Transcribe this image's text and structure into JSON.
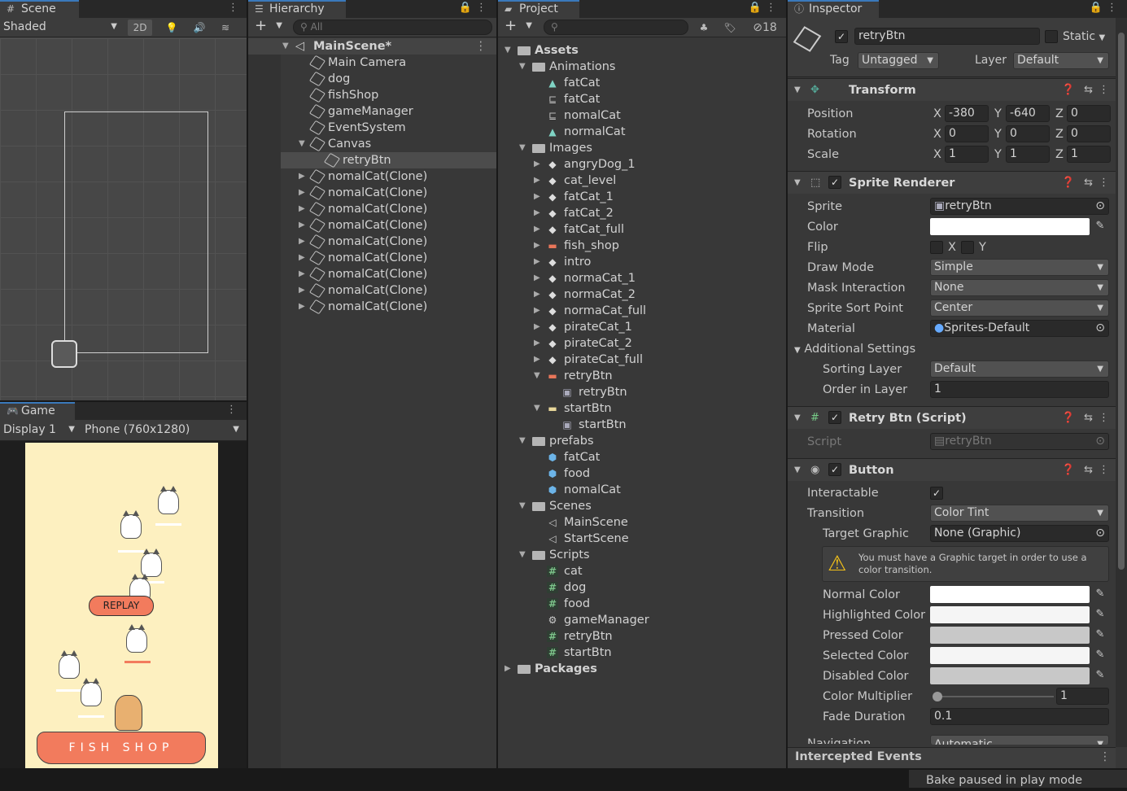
{
  "scene": {
    "tab": "Scene",
    "shading": "Shaded",
    "mode_2d": "2D"
  },
  "game": {
    "tab": "Game",
    "display": "Display 1",
    "resolution": "Phone (760x1280)",
    "replay_label": "REPLAY",
    "shop_sign": "FISH SHOP",
    "bg_color": "#fdf0c0",
    "awning_color": "#f27b5d"
  },
  "hierarchy": {
    "tab": "Hierarchy",
    "search_placeholder": "All",
    "scene_name": "MainScene*",
    "items": [
      {
        "label": "Main Camera",
        "depth": 1,
        "tri": ""
      },
      {
        "label": "dog",
        "depth": 1,
        "tri": ""
      },
      {
        "label": "fishShop",
        "depth": 1,
        "tri": ""
      },
      {
        "label": "gameManager",
        "depth": 1,
        "tri": ""
      },
      {
        "label": "EventSystem",
        "depth": 1,
        "tri": ""
      },
      {
        "label": "Canvas",
        "depth": 1,
        "tri": "open"
      },
      {
        "label": "retryBtn",
        "depth": 2,
        "tri": "",
        "selected": true
      },
      {
        "label": "nomalCat(Clone)",
        "depth": 1,
        "tri": "closed"
      },
      {
        "label": "nomalCat(Clone)",
        "depth": 1,
        "tri": "closed"
      },
      {
        "label": "nomalCat(Clone)",
        "depth": 1,
        "tri": "closed"
      },
      {
        "label": "nomalCat(Clone)",
        "depth": 1,
        "tri": "closed"
      },
      {
        "label": "nomalCat(Clone)",
        "depth": 1,
        "tri": "closed"
      },
      {
        "label": "nomalCat(Clone)",
        "depth": 1,
        "tri": "closed"
      },
      {
        "label": "nomalCat(Clone)",
        "depth": 1,
        "tri": "closed"
      },
      {
        "label": "nomalCat(Clone)",
        "depth": 1,
        "tri": "closed"
      },
      {
        "label": "nomalCat(Clone)",
        "depth": 1,
        "tri": "closed"
      }
    ]
  },
  "project": {
    "tab": "Project",
    "hidden_count": "18",
    "items": [
      {
        "label": "Assets",
        "depth": 0,
        "tri": "open",
        "icon": "folder",
        "bold": true
      },
      {
        "label": "Animations",
        "depth": 1,
        "tri": "open",
        "icon": "folder"
      },
      {
        "label": "fatCat",
        "depth": 2,
        "tri": "",
        "icon": "anim"
      },
      {
        "label": "fatCat",
        "depth": 2,
        "tri": "",
        "icon": "controller"
      },
      {
        "label": "nomalCat",
        "depth": 2,
        "tri": "",
        "icon": "controller"
      },
      {
        "label": "normalCat",
        "depth": 2,
        "tri": "",
        "icon": "anim"
      },
      {
        "label": "Images",
        "depth": 1,
        "tri": "open",
        "icon": "folder"
      },
      {
        "label": "angryDog_1",
        "depth": 2,
        "tri": "closed",
        "icon": "sprite"
      },
      {
        "label": "cat_level",
        "depth": 2,
        "tri": "closed",
        "icon": "sprite"
      },
      {
        "label": "fatCat_1",
        "depth": 2,
        "tri": "closed",
        "icon": "sprite"
      },
      {
        "label": "fatCat_2",
        "depth": 2,
        "tri": "closed",
        "icon": "sprite"
      },
      {
        "label": "fatCat_full",
        "depth": 2,
        "tri": "closed",
        "icon": "sprite"
      },
      {
        "label": "fish_shop",
        "depth": 2,
        "tri": "closed",
        "icon": "bar"
      },
      {
        "label": "intro",
        "depth": 2,
        "tri": "closed",
        "icon": "sprite"
      },
      {
        "label": "normaCat_1",
        "depth": 2,
        "tri": "closed",
        "icon": "sprite"
      },
      {
        "label": "normaCat_2",
        "depth": 2,
        "tri": "closed",
        "icon": "sprite"
      },
      {
        "label": "normaCat_full",
        "depth": 2,
        "tri": "closed",
        "icon": "sprite"
      },
      {
        "label": "pirateCat_1",
        "depth": 2,
        "tri": "closed",
        "icon": "sprite"
      },
      {
        "label": "pirateCat_2",
        "depth": 2,
        "tri": "closed",
        "icon": "sprite"
      },
      {
        "label": "pirateCat_full",
        "depth": 2,
        "tri": "closed",
        "icon": "sprite"
      },
      {
        "label": "retryBtn",
        "depth": 2,
        "tri": "open",
        "icon": "bar"
      },
      {
        "label": "retryBtn",
        "depth": 3,
        "tri": "",
        "icon": "subsprite"
      },
      {
        "label": "startBtn",
        "depth": 2,
        "tri": "open",
        "icon": "bar2"
      },
      {
        "label": "startBtn",
        "depth": 3,
        "tri": "",
        "icon": "subsprite"
      },
      {
        "label": "prefabs",
        "depth": 1,
        "tri": "open",
        "icon": "folder"
      },
      {
        "label": "fatCat",
        "depth": 2,
        "tri": "",
        "icon": "prefab"
      },
      {
        "label": "food",
        "depth": 2,
        "tri": "",
        "icon": "prefab"
      },
      {
        "label": "nomalCat",
        "depth": 2,
        "tri": "",
        "icon": "prefab"
      },
      {
        "label": "Scenes",
        "depth": 1,
        "tri": "open",
        "icon": "folder"
      },
      {
        "label": "MainScene",
        "depth": 2,
        "tri": "",
        "icon": "unity"
      },
      {
        "label": "StartScene",
        "depth": 2,
        "tri": "",
        "icon": "unity"
      },
      {
        "label": "Scripts",
        "depth": 1,
        "tri": "open",
        "icon": "folder"
      },
      {
        "label": "cat",
        "depth": 2,
        "tri": "",
        "icon": "script"
      },
      {
        "label": "dog",
        "depth": 2,
        "tri": "",
        "icon": "script"
      },
      {
        "label": "food",
        "depth": 2,
        "tri": "",
        "icon": "script"
      },
      {
        "label": "gameManager",
        "depth": 2,
        "tri": "",
        "icon": "gear"
      },
      {
        "label": "retryBtn",
        "depth": 2,
        "tri": "",
        "icon": "script"
      },
      {
        "label": "startBtn",
        "depth": 2,
        "tri": "",
        "icon": "script"
      },
      {
        "label": "Packages",
        "depth": 0,
        "tri": "closed",
        "icon": "folder",
        "bold": true
      }
    ]
  },
  "inspector": {
    "tab": "Inspector",
    "object_name": "retryBtn",
    "static_label": "Static",
    "tag_label": "Tag",
    "tag_value": "Untagged",
    "layer_label": "Layer",
    "layer_value": "Default",
    "transform": {
      "title": "Transform",
      "position_label": "Position",
      "rotation_label": "Rotation",
      "scale_label": "Scale",
      "x": "X",
      "y": "Y",
      "z": "Z",
      "position": [
        "-380",
        "-640",
        "0"
      ],
      "rotation": [
        "0",
        "0",
        "0"
      ],
      "scale": [
        "1",
        "1",
        "1"
      ]
    },
    "sprite_renderer": {
      "title": "Sprite Renderer",
      "sprite_label": "Sprite",
      "sprite_value": "retryBtn",
      "color_label": "Color",
      "flip_label": "Flip",
      "flip_x": "X",
      "flip_y": "Y",
      "draw_mode_label": "Draw Mode",
      "draw_mode": "Simple",
      "mask_label": "Mask Interaction",
      "mask": "None",
      "sort_point_label": "Sprite Sort Point",
      "sort_point": "Center",
      "material_label": "Material",
      "material": "Sprites-Default",
      "additional_label": "Additional Settings",
      "sorting_layer_label": "Sorting Layer",
      "sorting_layer": "Default",
      "order_label": "Order in Layer",
      "order": "1"
    },
    "retry_script": {
      "title": "Retry Btn (Script)",
      "script_label": "Script",
      "script_value": "retryBtn"
    },
    "button": {
      "title": "Button",
      "interactable_label": "Interactable",
      "transition_label": "Transition",
      "transition": "Color Tint",
      "target_label": "Target Graphic",
      "target": "None (Graphic)",
      "warning": "You must have a Graphic target in order to use a color transition.",
      "normal_label": "Normal Color",
      "normal_color": "#ffffff",
      "highlighted_label": "Highlighted Color",
      "highlighted_color": "#f5f5f5",
      "pressed_label": "Pressed Color",
      "pressed_color": "#c8c8c8",
      "selected_label": "Selected Color",
      "selected_color": "#f5f5f5",
      "disabled_label": "Disabled Color",
      "disabled_color": "#c8c8c8",
      "multiplier_label": "Color Multiplier",
      "multiplier": "1",
      "fade_label": "Fade Duration",
      "fade": "0.1",
      "navigation_label": "Navigation",
      "navigation": "Automatic"
    },
    "intercepted": "Intercepted Events"
  },
  "status": {
    "message": "Bake paused in play mode"
  }
}
